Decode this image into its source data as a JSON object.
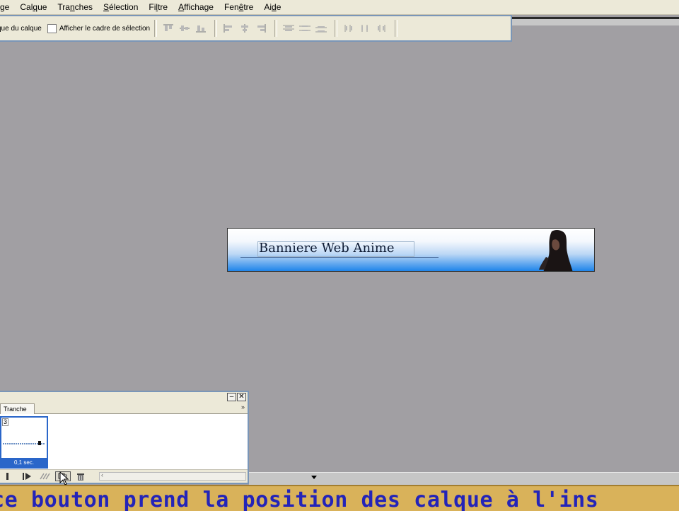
{
  "menu": {
    "items": [
      {
        "label": "ge",
        "accel": ""
      },
      {
        "label": "Calque",
        "accel": "q"
      },
      {
        "label": "Tranches",
        "accel": "n"
      },
      {
        "label": "Sélection",
        "accel": "S"
      },
      {
        "label": "Filtre",
        "accel": "l"
      },
      {
        "label": "Affichage",
        "accel": "A"
      },
      {
        "label": "Fenêtre",
        "accel": "ê"
      },
      {
        "label": "Aide",
        "accel": "d"
      }
    ]
  },
  "options": {
    "auto_select_label": "que du calque",
    "show_bounding_box_label": "Afficher le cadre de sélection",
    "show_bounding_box_checked": false,
    "align_icons": [
      "align-top-edges-icon",
      "align-vertical-centers-icon",
      "align-bottom-edges-icon",
      "align-left-edges-icon",
      "align-horizontal-centers-icon",
      "align-right-edges-icon"
    ],
    "distribute_icons": [
      "distribute-top-icon",
      "distribute-vcenter-icon",
      "distribute-bottom-icon",
      "distribute-left-icon",
      "distribute-hcenter-icon",
      "distribute-right-icon"
    ]
  },
  "canvas": {
    "banner_title": "Banniere Web Anime",
    "banner_gradient": [
      "#ffffff",
      "#1e84ea"
    ]
  },
  "animation_panel": {
    "tab_label": "Tranche",
    "frame_number": "3",
    "frame_delay": "0,1 sec.",
    "menu_arrow": "»"
  },
  "caption": {
    "text": "ce bouton prend la position des calque à l'ins"
  },
  "colors": {
    "workspace": "#a19fa3",
    "panel_bg": "#ece9d8",
    "selection_blue": "#2a66c9",
    "caption_text": "#2424b8",
    "caption_bg": "#d9b25a"
  }
}
